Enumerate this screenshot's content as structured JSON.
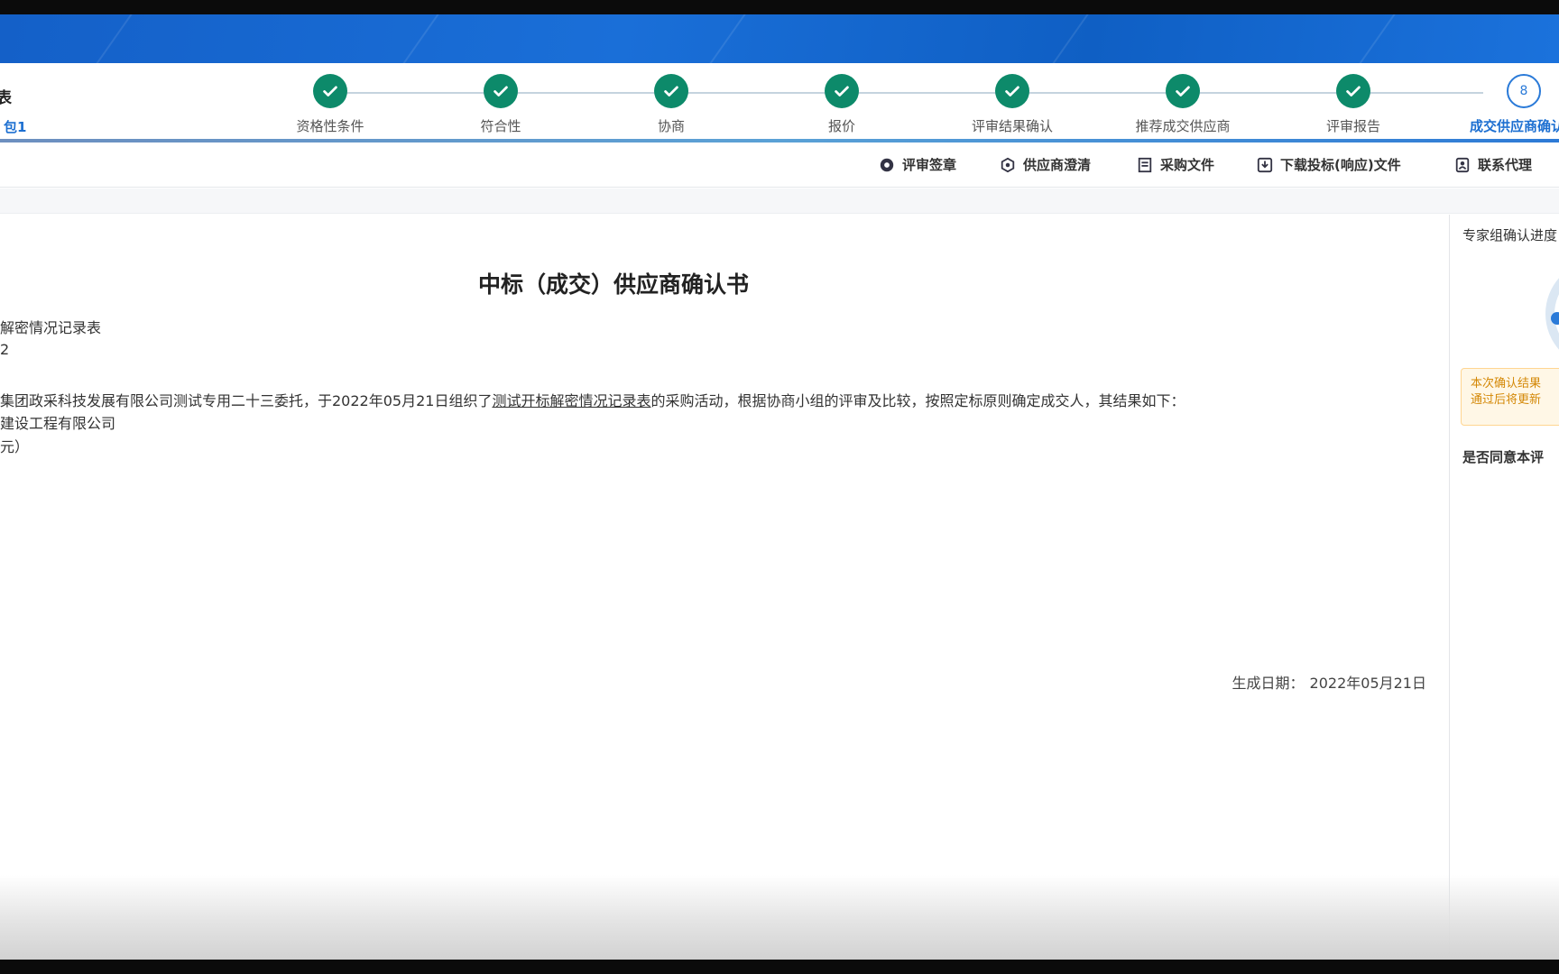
{
  "project": {
    "title_fragment": "表",
    "package_label": "包1"
  },
  "steps": [
    {
      "label": "资格性条件",
      "status": "done"
    },
    {
      "label": "符合性",
      "status": "done"
    },
    {
      "label": "协商",
      "status": "done"
    },
    {
      "label": "报价",
      "status": "done"
    },
    {
      "label": "评审结果确认",
      "status": "done"
    },
    {
      "label": "推荐成交供应商",
      "status": "done"
    },
    {
      "label": "评审报告",
      "status": "done"
    },
    {
      "label": "成交供应商确认书",
      "status": "current",
      "number": "8"
    }
  ],
  "colors": {
    "banner_blue": "#1a6fd8",
    "step_done": "#0d8a6a",
    "step_current": "#2a7ad8",
    "notice_text": "#d48806"
  },
  "toolbar": {
    "items": [
      {
        "label": "评审签章",
        "icon": "seal-icon"
      },
      {
        "label": "供应商澄清",
        "icon": "clarify-icon"
      },
      {
        "label": "采购文件",
        "icon": "document-icon"
      },
      {
        "label": "下载投标(响应)文件",
        "icon": "download-icon"
      },
      {
        "label": "联系代理",
        "icon": "contact-icon"
      }
    ]
  },
  "document": {
    "title": "中标（成交）供应商确认书",
    "project_name_fragment": "解密情况记录表",
    "project_code_fragment": "2",
    "body_prefix": "集团政采科技发展有限公司测试专用二十三委托，于2022年05月21日组织了",
    "body_link": "测试开标解密情况记录表",
    "body_suffix": "的采购活动，根据协商小组的评审及比较，按照定标原则确定成交人，其结果如下：",
    "winner_fragment": "建设工程有限公司",
    "amount_fragment": "元）",
    "date_label": "生成日期：",
    "date_value": "2022年05月21日"
  },
  "side_panel": {
    "title": "专家组确认进度",
    "notice_line1": "本次确认结果",
    "notice_line2": "通过后将更新",
    "question": "是否同意本评"
  }
}
